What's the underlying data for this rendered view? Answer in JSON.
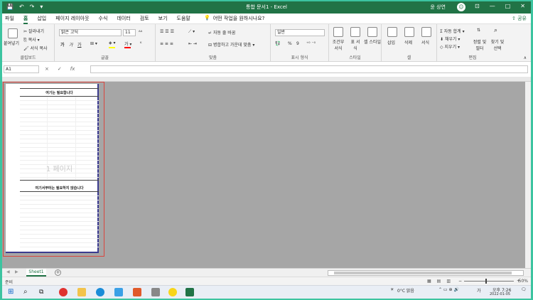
{
  "window": {
    "title": "통합 문서1  -  Excel",
    "user": "윤 상연"
  },
  "tabs": [
    "파일",
    "홈",
    "삽입",
    "페이지 레이아웃",
    "수식",
    "데이터",
    "검토",
    "보기",
    "도움말"
  ],
  "tell_me": "어떤 작업을 원하시나요?",
  "share_label": "공유",
  "ribbon": {
    "clipboard": {
      "paste": "붙여넣기",
      "cut": "잘라내기",
      "copy": "복사",
      "format_painter": "서식 복사",
      "label": "클립보드"
    },
    "font": {
      "name": "맑은 고딕",
      "size": "11",
      "bold": "가",
      "italic": "가",
      "underline": "가",
      "label": "글꼴"
    },
    "alignment": {
      "wrap": "자동 줄 바꿈",
      "merge": "병합하고 가운데 맞춤",
      "label": "맞춤"
    },
    "number": {
      "format": "일반",
      "percent": "%",
      "comma": "9",
      "label": "표시 형식"
    },
    "styles": {
      "conditional": "조건부 서식",
      "table": "표 서식",
      "cell": "셀 스타일",
      "label": "스타일"
    },
    "cells": {
      "insert": "삽입",
      "delete": "삭제",
      "format": "서식",
      "label": "셀"
    },
    "editing": {
      "autosum": "자동 합계",
      "fill": "채우기",
      "clear": "지우기",
      "sort": "정렬 및 필터",
      "find": "찾기 및 선택",
      "label": "편집"
    }
  },
  "formula_bar": {
    "name_box": "A1",
    "cancel": "×",
    "enter": "✓",
    "fx": "fx"
  },
  "page": {
    "title1": "여기는 필요합니다",
    "watermark": "1 페이지",
    "title2": "여기서부터는 필요하지 않습니다"
  },
  "sheet_tab": "Sheet1",
  "status": {
    "text": "준비",
    "zoom": "50%"
  },
  "taskbar": {
    "weather": "0°C 맑음",
    "time": "오후 7:26",
    "date": "2022-01-05",
    "lang": "가"
  },
  "colors": {
    "excel_green": "#217346",
    "page_border": "#d9453e",
    "taskbar_bg": "#e9eef5"
  }
}
